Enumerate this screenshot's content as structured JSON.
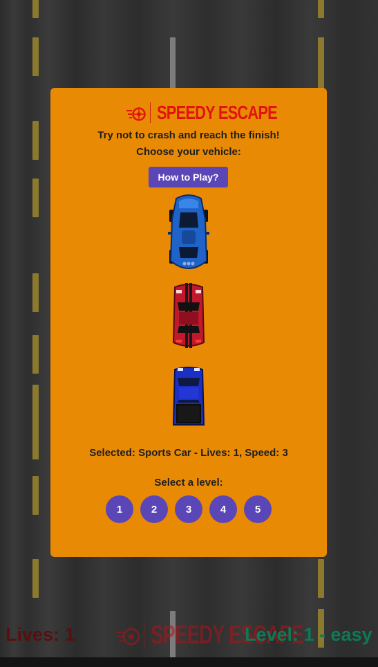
{
  "game": {
    "title": "SPEEDY ESCAPE",
    "tagline": "Try not to crash and reach the finish!",
    "choose_prompt": "Choose your vehicle:",
    "how_to_play_label": "How to Play?",
    "selected_text": "Selected: Sports Car - Lives: 1, Speed: 3",
    "level_prompt": "Select a level:",
    "levels": [
      "1",
      "2",
      "3",
      "4",
      "5"
    ]
  },
  "vehicles": [
    {
      "name": "sports-car",
      "color": "#1f63c9"
    },
    {
      "name": "muscle-car",
      "color": "#c0192c"
    },
    {
      "name": "pickup-truck",
      "color": "#1c2fc4"
    }
  ],
  "hud": {
    "lives_text": "Lives: 1",
    "level_text": "Level: 1 - easy"
  },
  "colors": {
    "modal_bg": "#e98a05",
    "button": "#5b46b7",
    "logo_red": "#e0150d",
    "lives": "#5a0f0f",
    "level": "#0c7a55"
  }
}
